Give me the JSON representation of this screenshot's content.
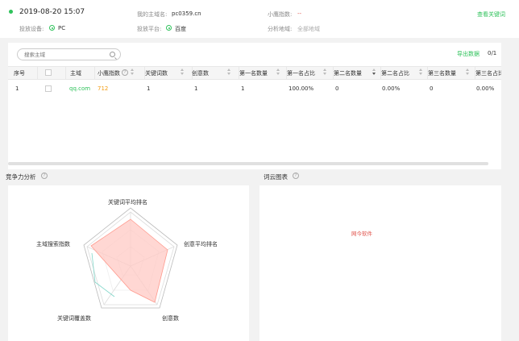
{
  "header": {
    "datetime": "2019-08-20 15:07",
    "device_label": "投放设备:",
    "device_value": "PC",
    "domain_label": "我的主域名:",
    "domain_value": "pc0359.cn",
    "platform_label": "投放平台:",
    "platform_value": "百度",
    "index_label": "小鹰指数:",
    "index_value": "--",
    "region_label": "分析地域:",
    "region_value": "全部地域",
    "view_keywords_link": "查看关键词",
    "status_color": "#2fc25b"
  },
  "table_card": {
    "search_placeholder": "搜索主域",
    "export_label": "导出数据",
    "page_count": "0/1",
    "columns": [
      "序号",
      "",
      "主域",
      "小鹰指数",
      "关键词数",
      "创意数",
      "第一名数量",
      "第一名占比",
      "第二名数量",
      "第二名占比",
      "第三名数量",
      "第三名占比"
    ],
    "rows": [
      {
        "index": "1",
        "domain": "qq.com",
        "score": "712",
        "keywords": "1",
        "creatives": "1",
        "first_count": "1",
        "first_ratio": "100.00%",
        "second_count": "0",
        "second_ratio": "0.00%",
        "third_count": "0",
        "third_ratio": "0.00%"
      }
    ],
    "domain_color": "#2fc25b",
    "score_color": "#f39c12"
  },
  "competition": {
    "title": "竞争力分析",
    "radar_axes": [
      "关键词平均排名",
      "创意平均排名",
      "创意数",
      "关键词覆盖数",
      "主域搜索指数"
    ],
    "fill_color": "#ffc9c4"
  },
  "wordcloud": {
    "title": "词云图表",
    "words": [
      "网今软件"
    ]
  }
}
